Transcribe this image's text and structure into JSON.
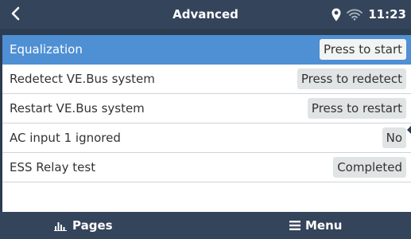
{
  "header": {
    "title": "Advanced",
    "time": "11:23",
    "icons": [
      "back-arrow-icon",
      "location-pin-icon",
      "wifi-icon"
    ]
  },
  "rows": [
    {
      "label": "Equalization",
      "value": "Press to start",
      "selected": true
    },
    {
      "label": "Redetect VE.Bus system",
      "value": "Press to redetect",
      "selected": false
    },
    {
      "label": "Restart VE.Bus system",
      "value": "Press to restart",
      "selected": false
    },
    {
      "label": "AC input 1 ignored",
      "value": "No",
      "selected": false
    },
    {
      "label": "ESS Relay test",
      "value": "Completed",
      "selected": false
    }
  ],
  "footer": {
    "pages_label": "Pages",
    "menu_label": "Menu",
    "icons": [
      "pages-bar-chart-icon",
      "menu-hamburger-icon"
    ]
  },
  "colors": {
    "header_bg": "#34445a",
    "background": "#2c3c51",
    "selected_row": "#4f8fd4",
    "value_box": "#e1e4e4"
  }
}
